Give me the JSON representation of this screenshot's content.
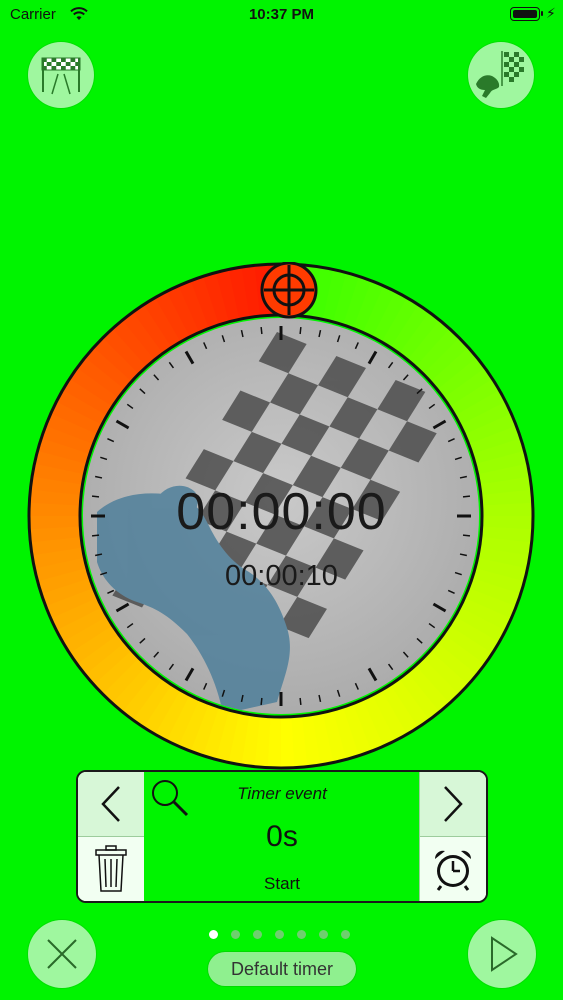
{
  "status_bar": {
    "carrier": "Carrier",
    "time": "10:37 PM"
  },
  "header": {
    "left_button_icon": "checkered-finish-line-icon",
    "right_button_icon": "racer-with-flag-icon"
  },
  "dial": {
    "outer_ring_colors": [
      "#ff1a00",
      "#ff8c00",
      "#ffff00",
      "#aaff00",
      "#33ff00"
    ],
    "target_icon": "crosshair-icon",
    "background_image": "checkered-flag-racer-icon",
    "main_time": "00:00:00",
    "sub_time": "00:00:10"
  },
  "event_panel": {
    "prev_icon": "chevron-left-icon",
    "next_icon": "chevron-right-icon",
    "search_icon": "search-icon",
    "delete_icon": "trash-icon",
    "alarm_icon": "alarm-clock-icon",
    "title": "Timer event",
    "value": "0s",
    "status": "Start"
  },
  "footer": {
    "close_icon": "close-icon",
    "play_icon": "play-icon",
    "page_count": 7,
    "active_page": 0,
    "preset_label": "Default timer"
  }
}
